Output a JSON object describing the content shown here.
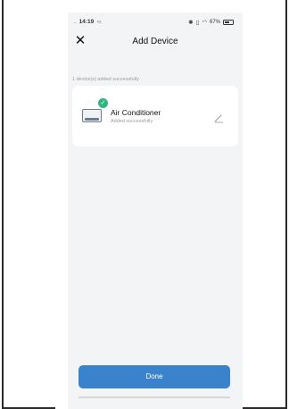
{
  "status_bar": {
    "signal": "....",
    "time": "14:19",
    "network": "⁴G",
    "battery_percent": "67%",
    "battery_level": 0.67
  },
  "header": {
    "title": "Add Device",
    "close_icon": "close-icon"
  },
  "main": {
    "success_message": "1 device(s) added successfully",
    "devices": [
      {
        "name": "Air Conditioner",
        "status": "Added successfully",
        "icon": "air-conditioner-icon",
        "badge_icon": "check-icon",
        "badge_color": "#2fb67c"
      }
    ]
  },
  "footer": {
    "done_label": "Done"
  },
  "colors": {
    "accent": "#3b82cc",
    "success": "#2fb67c",
    "background": "#f3f4f6"
  }
}
